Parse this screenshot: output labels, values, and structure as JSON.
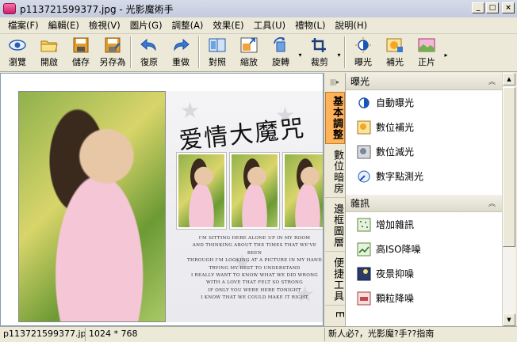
{
  "window": {
    "title": "p113721599377.jpg - 光影魔術手"
  },
  "menu": [
    "檔案(F)",
    "編輯(E)",
    "檢視(V)",
    "圖片(G)",
    "調整(A)",
    "效果(E)",
    "工具(U)",
    "禮物(L)",
    "說明(H)"
  ],
  "toolbar": {
    "tools": [
      {
        "label": "瀏覽",
        "icon": "eye-icon"
      },
      {
        "label": "開啟",
        "icon": "folder-open-icon"
      },
      {
        "label": "儲存",
        "icon": "save-icon"
      },
      {
        "label": "另存為",
        "icon": "save-as-icon"
      },
      {
        "label": "復原",
        "icon": "undo-icon"
      },
      {
        "label": "重做",
        "icon": "redo-icon"
      },
      {
        "label": "對照",
        "icon": "compare-icon"
      },
      {
        "label": "縮放",
        "icon": "resize-icon"
      },
      {
        "label": "旋轉",
        "icon": "rotate-icon"
      },
      {
        "label": "裁剪",
        "icon": "crop-icon"
      },
      {
        "label": "曝光",
        "icon": "exposure-icon"
      },
      {
        "label": "補光",
        "icon": "fill-light-icon"
      },
      {
        "label": "正片",
        "icon": "film-positive-icon"
      }
    ]
  },
  "workspace": {
    "art_title": "爱情大魔咒",
    "poem_lines": [
      "I'M SITTING HERE ALONE UP IN MY ROOM",
      "AND THINKING ABOUT THE TIMES THAT WE'VE BEEN",
      "THROUGH I'M LOOKING AT A PICTURE IN MY HAND",
      "TRYING MY BEST TO UNDERSTAND",
      "I REALLY WANT TO KNOW WHAT WE DID WRONG",
      "WITH A LOVE THAT FELT SO STRONG",
      "IF ONLY YOU WERE HERE TONIGHT",
      "I KNOW THAT WE COULD MAKE IT RIGHT"
    ]
  },
  "side_tabs": [
    "基本調整",
    "數位暗房",
    "邊框圖層",
    "便捷工具",
    "E"
  ],
  "panel": {
    "sections": [
      {
        "title": "曝光",
        "items": [
          "自動曝光",
          "數位補光",
          "數位減光",
          "數字點測光"
        ]
      },
      {
        "title": "雜訊",
        "items": [
          "增加雜訊",
          "高ISO降噪",
          "夜景抑噪",
          "顆粒降噪"
        ]
      }
    ]
  },
  "status": {
    "filename": "p113721599377.jpg",
    "dimensions": "1024 * 768",
    "hint": "新人必?，光影魔?手??指南"
  }
}
